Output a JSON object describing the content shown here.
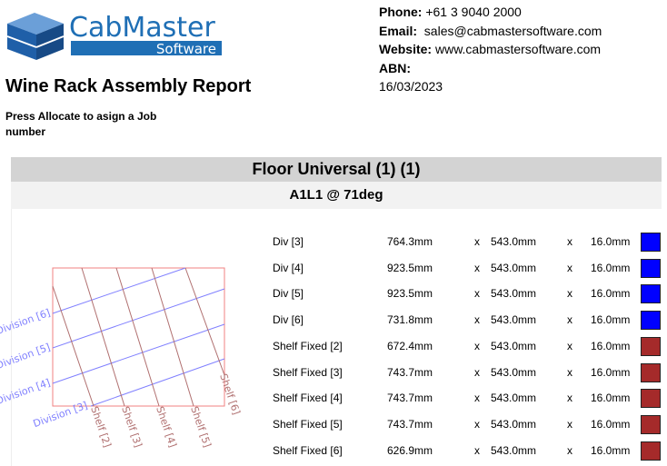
{
  "logo": {
    "brand": "CabMaster",
    "sub": "Software",
    "color": "#1f6fb5"
  },
  "report": {
    "title": "Wine Rack Assembly Report",
    "job_note": "Press Allocate to asign a Job number"
  },
  "contact": {
    "phone_label": "Phone:",
    "phone": "+61 3 9040 2000",
    "email_label": "Email:",
    "email": "sales@cabmastersoftware.com",
    "website_label": "Website:",
    "website": "www.cabmastersoftware.com",
    "abn_label": "ABN:",
    "date": "16/03/2023"
  },
  "section": {
    "title": "Floor Universal (1) (1)",
    "subtitle": "A1L1 @ 71deg"
  },
  "colors": {
    "division": "#0000ff",
    "shelf": "#a52a2a",
    "frame": "#f08080"
  },
  "drawing": {
    "division_labels": [
      "Division [3]",
      "Division [4]",
      "Division [5]",
      "Division [6]"
    ],
    "shelf_labels": [
      "Shelf [2]",
      "Shelf [3]",
      "Shelf [4]",
      "Shelf [5]",
      "Shelf [6]"
    ]
  },
  "parts": [
    {
      "name": "Div [3]",
      "length": "764.3mm",
      "width": "543.0mm",
      "thickness": "16.0mm",
      "type": "division"
    },
    {
      "name": "Div [4]",
      "length": "923.5mm",
      "width": "543.0mm",
      "thickness": "16.0mm",
      "type": "division"
    },
    {
      "name": "Div [5]",
      "length": "923.5mm",
      "width": "543.0mm",
      "thickness": "16.0mm",
      "type": "division"
    },
    {
      "name": "Div [6]",
      "length": "731.8mm",
      "width": "543.0mm",
      "thickness": "16.0mm",
      "type": "division"
    },
    {
      "name": "Shelf Fixed [2]",
      "length": "672.4mm",
      "width": "543.0mm",
      "thickness": "16.0mm",
      "type": "shelf"
    },
    {
      "name": "Shelf Fixed [3]",
      "length": "743.7mm",
      "width": "543.0mm",
      "thickness": "16.0mm",
      "type": "shelf"
    },
    {
      "name": "Shelf Fixed [4]",
      "length": "743.7mm",
      "width": "543.0mm",
      "thickness": "16.0mm",
      "type": "shelf"
    },
    {
      "name": "Shelf Fixed [5]",
      "length": "743.7mm",
      "width": "543.0mm",
      "thickness": "16.0mm",
      "type": "shelf"
    },
    {
      "name": "Shelf Fixed [6]",
      "length": "626.9mm",
      "width": "543.0mm",
      "thickness": "16.0mm",
      "type": "shelf"
    }
  ],
  "times_sign": "x"
}
